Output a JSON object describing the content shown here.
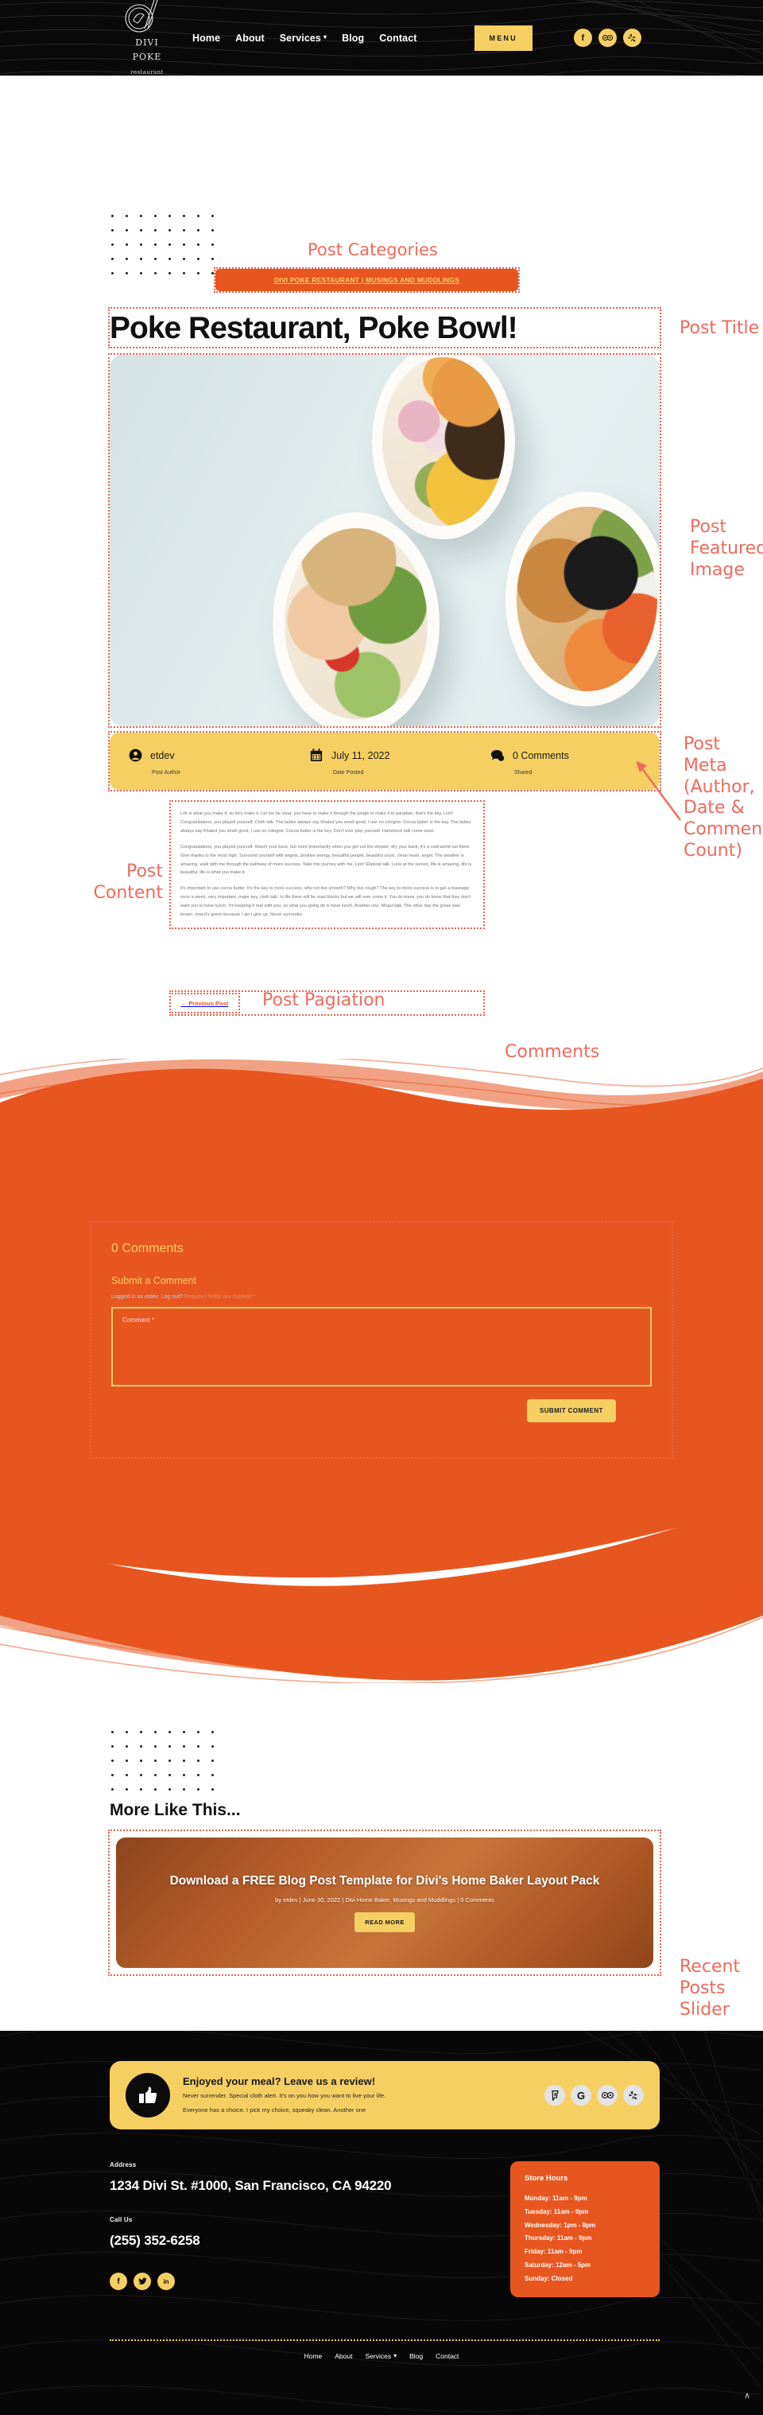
{
  "header": {
    "logo": {
      "line1": "DIVI POKE",
      "line2": "restaurant",
      "icon": "poke-bowl-chopsticks-logo"
    },
    "nav": [
      {
        "label": "Home",
        "has_submenu": false
      },
      {
        "label": "About",
        "has_submenu": false
      },
      {
        "label": "Services",
        "has_submenu": true
      },
      {
        "label": "Blog",
        "has_submenu": false
      },
      {
        "label": "Contact",
        "has_submenu": false
      }
    ],
    "menu_button": "MENU",
    "socials": [
      {
        "name": "facebook-icon",
        "glyph": "f"
      },
      {
        "name": "tripadvisor-icon",
        "glyph": "ѳѳ"
      },
      {
        "name": "yelp-icon",
        "glyph": "⁂"
      }
    ]
  },
  "post": {
    "categories_label": "Post Categories",
    "category_pill": "DIVI POKE RESTAURANT | MUSINGS AND MUDDLINGS",
    "title": "Poke Restaurant, Poke Bowl!",
    "featured_image_alt": "three poke bowls on a light blue table",
    "meta": {
      "author": {
        "value": "etdev",
        "caption": "Post Author",
        "icon": "user-icon"
      },
      "date": {
        "value": "July 11, 2022",
        "caption": "Date Posted",
        "icon": "calendar-icon"
      },
      "comments": {
        "value": "0 Comments",
        "caption": "Shared",
        "icon": "comment-bubble-icon"
      }
    },
    "body": [
      "Life is what you make it, so let's make it. Let me be clear, you have to make it through the jungle to make it to paradise, that's the key, Lion! Congratulations, you played yourself. Cloth talk. The ladies always say Khaled you smell good, I use no cologne. Cocoa butter is the key. The ladies always say Khaled you smell good, I use no cologne. Cocoa butter is the key. Don't ever play yourself. Hammock talk come soon.",
      "Congratulations, you played yourself. Watch your back, but more importantly when you get out the shower, dry your back, it's a cold world out there. Give thanks to the most high. Surround yourself with angels, positive energy, beautiful people, beautiful souls, clean heart, angel. The weather is amazing, walk with me through the pathway of more success. Take this journey with me, Lion! Eliptical talk. Look at the sunset, life is amazing, life is beautiful, life is what you make it.",
      "It's important to use cocoa butter. It's the key to more success, why not live smooth? Why live rough? The key to more success is to get a massage once a week, very important, major key, cloth talk. In life there will be road blocks but we will over come it. You do know, you do know that they don't want you to have lunch. I'm keeping it real with you, so what you going do is have lunch. Another one. Mogul talk. The other day the grass was brown, now it's green because I ain't give up. Never surrender."
    ],
    "pagination": {
      "previous": "← Previous Post"
    }
  },
  "annotations": {
    "post_title": "Post Title",
    "post_featured_image": "Post\nFeatured\nImage",
    "post_meta": "Post\nMeta\n(Author,\nDate &\nComment\nCount)",
    "post_content": "Post\nContent",
    "post_pagination": "Post Pagiation",
    "comments": "Comments",
    "recent_posts_slider": "Recent\nPosts\nSlider"
  },
  "comments_section": {
    "count_heading": "0 Comments",
    "submit_heading": "Submit a Comment",
    "logged_in_text": "Logged in as etdev. Log out?",
    "required_text": "Required fields are marked *",
    "comment_placeholder": "Comment *",
    "comment_value": "",
    "submit_button": "SUBMIT COMMENT"
  },
  "more_like_this": {
    "heading": "More Like This...",
    "slide": {
      "title": "Download a FREE Blog Post Template for Divi's Home Baker Layout Pack",
      "meta": "by etdev | June 30, 2022 | Divi Home Baker, Musings and Muddlings | 0 Comments",
      "button": "READ MORE",
      "image_alt": "loaf of bread in paper on a wooden board"
    }
  },
  "footer": {
    "review_card": {
      "heading": "Enjoyed your meal? Leave us a review!",
      "line1": "Never surrender. Special cloth alert. It's on you how you want to live your life.",
      "line2": "Everyone has a choice. I pick my choice, squeaky clean. Another one",
      "icon": "thumbs-up-icon",
      "socials": [
        {
          "name": "foursquare-icon",
          "glyph": "Ŧ"
        },
        {
          "name": "google-icon",
          "glyph": "G"
        },
        {
          "name": "tripadvisor-icon",
          "glyph": "ѳѳ"
        },
        {
          "name": "yelp-icon",
          "glyph": "⁂"
        }
      ]
    },
    "address_label": "Address",
    "address_value": "1234 Divi St. #1000, San Francisco, CA 94220",
    "call_label": "Call Us",
    "call_value": "(255) 352-6258",
    "socials": [
      {
        "name": "facebook-icon",
        "glyph": "f"
      },
      {
        "name": "twitter-icon",
        "glyph": "ᴠ"
      },
      {
        "name": "linkedin-icon",
        "glyph": "in"
      }
    ],
    "store_hours": {
      "heading": "Store Hours",
      "rows": [
        "Monday: 11am - 9pm",
        "Tuesday: 11am - 9pm",
        "Wednesday: 1pm - 8pm",
        "Thursday: 11am - 9pm",
        "Friday: 11am - 9pm",
        "Saturday: 12am - 5pm",
        "Sunday: Closed"
      ]
    },
    "nav": [
      {
        "label": "Home",
        "has_submenu": false
      },
      {
        "label": "About",
        "has_submenu": false
      },
      {
        "label": "Services",
        "has_submenu": true
      },
      {
        "label": "Blog",
        "has_submenu": false
      },
      {
        "label": "Contact",
        "has_submenu": false
      }
    ],
    "scroll_top": "∧"
  },
  "colors": {
    "brand_orange": "#e8561f",
    "brand_yellow": "#f6cf62",
    "annotation_red": "#ef6a5c",
    "dark": "#0a0a0a"
  }
}
